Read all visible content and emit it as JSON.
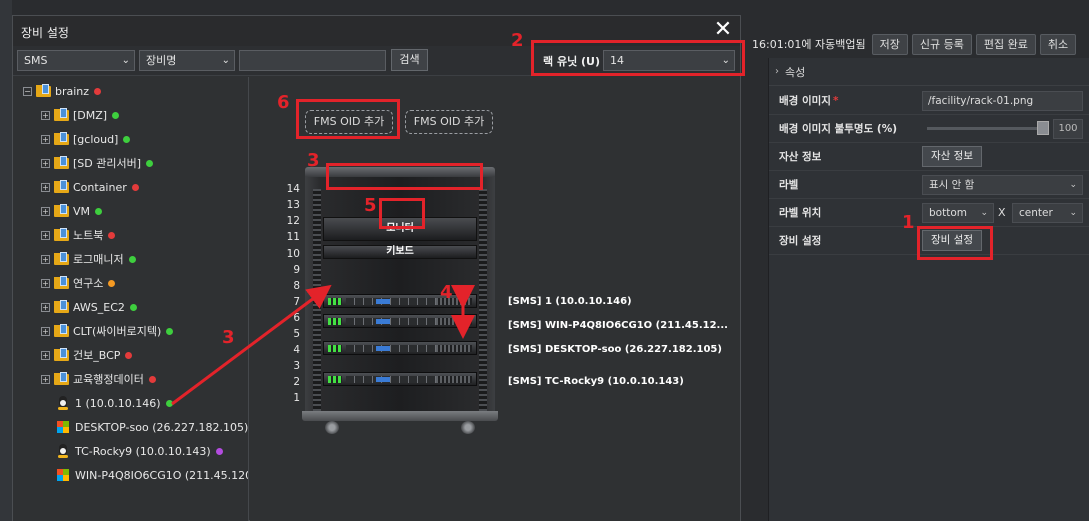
{
  "background_app": {
    "autosave_text": "16:01:01에 자동백업됨",
    "buttons": {
      "save": "저장",
      "new": "신규 등록",
      "edit_done": "편집 완료",
      "cancel": "취소"
    },
    "properties": {
      "header": "속성",
      "rows": {
        "bg_image": {
          "label": "배경 이미지",
          "required_mark": "*",
          "value": "/facility/rack-01.png"
        },
        "bg_opacity": {
          "label": "배경 이미지 불투명도 (%)",
          "value": "100",
          "level_percent": 100
        },
        "asset_info": {
          "label": "자산 정보",
          "button": "자산 정보"
        },
        "label": {
          "label": "라벨",
          "value": "표시 안 함"
        },
        "label_pos": {
          "label": "라벨 위치",
          "vertical": "bottom",
          "x_sep": "X",
          "horizontal": "center"
        },
        "equip_settings": {
          "label": "장비 설정",
          "button": "장비 설정"
        }
      }
    }
  },
  "dialog": {
    "title": "장비 설정",
    "close_glyph": "✕",
    "toolbar": {
      "type_select": "SMS",
      "field_select": "장비명",
      "search_value": "",
      "search_button": "검색",
      "rack_unit_label": "랙 유닛 (U)",
      "rack_unit_value": "14"
    },
    "tree": {
      "root": {
        "label": "brainz",
        "status": "red"
      },
      "groups": [
        {
          "label": "[DMZ]",
          "status": "green"
        },
        {
          "label": "[gcloud]",
          "status": "green"
        },
        {
          "label": "[SD 관리서버]",
          "status": "green"
        },
        {
          "label": "Container",
          "status": "red"
        },
        {
          "label": "VM",
          "status": "green"
        },
        {
          "label": "노트북",
          "status": "red"
        },
        {
          "label": "로그매니저",
          "status": "green"
        },
        {
          "label": "연구소",
          "status": "orange"
        },
        {
          "label": "AWS_EC2",
          "status": "green"
        },
        {
          "label": "CLT(싸이버로지텍)",
          "status": "green"
        },
        {
          "label": "건보_BCP",
          "status": "red"
        },
        {
          "label": "교육행정데이터",
          "status": "red"
        }
      ],
      "devices": [
        {
          "label": "1 (10.0.10.146)",
          "os": "linux",
          "status": "green"
        },
        {
          "label": "DESKTOP-soo (26.227.182.105)",
          "os": "windows",
          "status": "green"
        },
        {
          "label": "TC-Rocky9 (10.0.10.143)",
          "os": "linux",
          "status": "purple"
        },
        {
          "label": "WIN-P4Q8IO6CG1O (211.45.120.",
          "os": "windows",
          "status": ""
        }
      ]
    },
    "canvas": {
      "oid_buttons": [
        "FMS OID 추가",
        "FMS OID 추가"
      ],
      "rack_units": [
        "14",
        "13",
        "12",
        "11",
        "10",
        "9",
        "8",
        "7",
        "6",
        "5",
        "4",
        "3",
        "2",
        "1"
      ],
      "slot_monitor": "모니터",
      "slot_keyboard": "키보드",
      "servers": [
        "[SMS] 1 (10.0.10.146)",
        "[SMS] WIN-P4Q8IO6CG1O (211.45.12...",
        "[SMS] DESKTOP-soo (26.227.182.105)",
        "[SMS] TC-Rocky9 (10.0.10.143)"
      ]
    }
  },
  "annotations": [
    "1",
    "2",
    "3",
    "3",
    "4",
    "5",
    "6"
  ],
  "colors": {
    "annotation_red": "#e3232a",
    "status_red": "#e33b3b",
    "status_green": "#3ecf3e",
    "status_orange": "#f59a23",
    "status_purple": "#b34ce0"
  }
}
